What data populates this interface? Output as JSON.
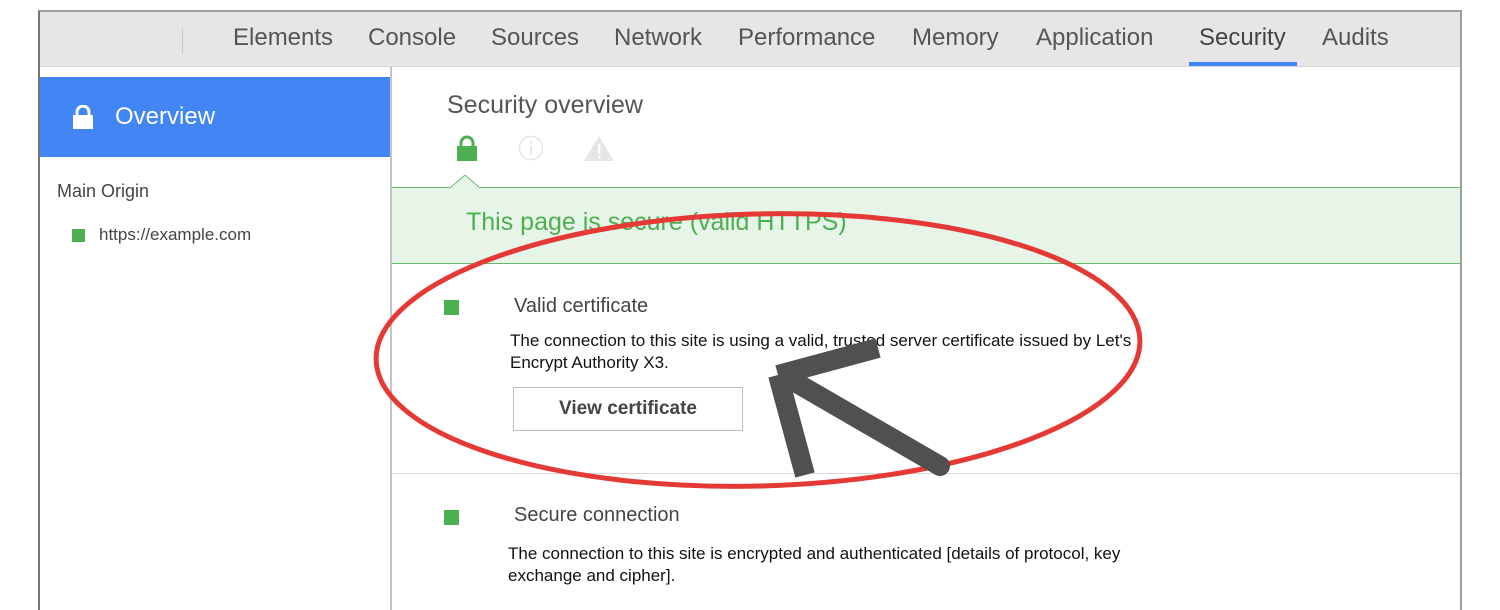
{
  "tabs": [
    {
      "label": "Elements",
      "active": false
    },
    {
      "label": "Console",
      "active": false
    },
    {
      "label": "Sources",
      "active": false
    },
    {
      "label": "Network",
      "active": false
    },
    {
      "label": "Performance",
      "active": false
    },
    {
      "label": "Memory",
      "active": false
    },
    {
      "label": "Application",
      "active": false
    },
    {
      "label": "Security",
      "active": true
    },
    {
      "label": "Audits",
      "active": false
    }
  ],
  "sidebar": {
    "overview_label": "Overview",
    "overview_icon": "lock-icon",
    "origin_heading": "Main Origin",
    "origins": [
      {
        "label": "https://example.com",
        "status_color": "#4caf50"
      }
    ]
  },
  "main": {
    "title": "Security overview",
    "summary_icons": [
      "lock-icon",
      "info-icon",
      "warning-icon"
    ],
    "banner_text": "This page is secure (valid HTTPS)",
    "sections": [
      {
        "title": "Valid certificate",
        "description": "The connection to this site is using a valid, trusted server certificate issued by Let's Encrypt Authority X3.",
        "button_label": "View certificate"
      },
      {
        "title": "Secure connection",
        "description": "The connection to this site is encrypted and authenticated [details of protocol, key exchange and cipher]."
      }
    ]
  },
  "colors": {
    "accent": "#4285f4",
    "secure_green": "#4caf50",
    "banner_bg": "#e7f4e8",
    "annotation_red": "#e53935",
    "annotation_arrow": "#505050"
  },
  "annotations": {
    "ellipse": "red-ellipse-highlight",
    "arrow": "arrow-pointing-to-certificate"
  }
}
